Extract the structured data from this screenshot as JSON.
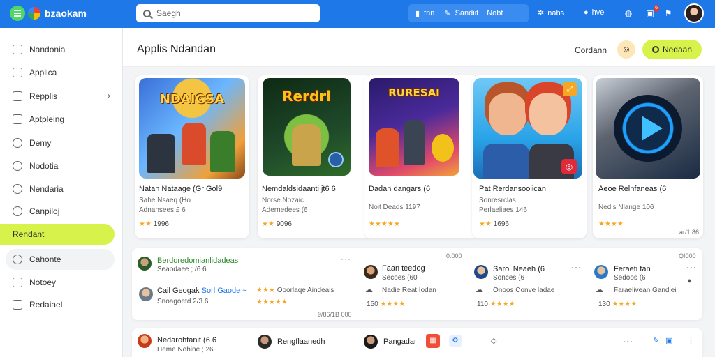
{
  "header": {
    "brand": "bzaokam",
    "search_placeholder": "Saegh",
    "group_label_1": "tnn",
    "group_label_2": "Sandiit",
    "group_label_3": "Nobt",
    "nav_item": "nabs",
    "nav_item_2": "hve",
    "badge_count": "6"
  },
  "sidebar": {
    "items": [
      {
        "label": "Nandonia"
      },
      {
        "label": "Applica"
      },
      {
        "label": "Repplis"
      },
      {
        "label": "Aptpleing"
      },
      {
        "label": "Demy"
      },
      {
        "label": "Nodotia"
      },
      {
        "label": "Nendaria"
      },
      {
        "label": "Canpiloj"
      },
      {
        "label": "Rendant"
      },
      {
        "label": "Cahonte"
      },
      {
        "label": "Notoey"
      },
      {
        "label": "Redaiael"
      }
    ]
  },
  "page": {
    "title": "Applis Ndandan",
    "link": "Cordann",
    "cta": "Nedaan"
  },
  "cards": [
    {
      "art": "NDAIGSA",
      "title": "Natan Nataage (Gr Gol9",
      "sub1": "Sahe Nsaeq (Ho",
      "sub2": "Adnansees £ 6",
      "rating": "1996",
      "colors": [
        "#3a6fd8",
        "#f1a03a"
      ]
    },
    {
      "art": "Rerdrl",
      "title": "Nemdaldsidaanti jt6 6",
      "sub1": "Norse Nozaic",
      "sub2": "Adernedees (6",
      "rating": "9096",
      "colors": [
        "#1f4a2a",
        "#7bc043"
      ]
    },
    {
      "art": "RURESAI",
      "title": "Dadan dangars (6",
      "sub1": "",
      "sub2": "Noit Deads 1197",
      "rating": "",
      "colors": [
        "#4a2a9a",
        "#e24a6a"
      ]
    },
    {
      "art": "",
      "title": "Pat Rerdansoolican",
      "sub1": "Sonresrclas",
      "sub2": "Perlaeliaes 146",
      "rating": "1696",
      "colors": [
        "#2aa3e8",
        "#f28a3a"
      ]
    },
    {
      "art": "",
      "title": "Aeoe Relnfaneas (6",
      "sub1": "",
      "sub2": "Nedis Nlange 106",
      "rating": "",
      "corner": "ar/1 86",
      "colors": [
        "#5d6470",
        "#1a2b44"
      ]
    }
  ],
  "reviews": {
    "r1": {
      "name": "Berdoredomianlidadeas",
      "sub": "Seaodaee ; /6 6"
    },
    "r2": {
      "name": "Cail Geogak",
      "name2": "Sorl Gaode ~",
      "sub": "Snoagoetd 2/3 6"
    },
    "r2b": {
      "text": "Ooorlaqe Aindeals"
    },
    "r3": {
      "name": "Faan teedog",
      "sub": "Secoes (60",
      "line": "Nadie Reat Iodan",
      "count": "150"
    },
    "r4": {
      "name": "Sarol Neaeh (6",
      "sub": "Sonces (6",
      "line": "Onoos Conve ladae",
      "count": "110"
    },
    "r5": {
      "name": "Feraeti fan",
      "sub": "Sedoos (6",
      "line": "Faraelivean Gandiei",
      "count": "130"
    },
    "corner_1": "0:000",
    "corner_2": "Q!000",
    "footer_tiny": "9/86/1B 000"
  },
  "bottom": {
    "r1": {
      "name": "Nedarohtanit (6 6",
      "sub": "Heme Nohine ; 26"
    },
    "r2": {
      "name": "Rengflaanedh"
    },
    "r3": {
      "name": "Pangadar"
    }
  }
}
